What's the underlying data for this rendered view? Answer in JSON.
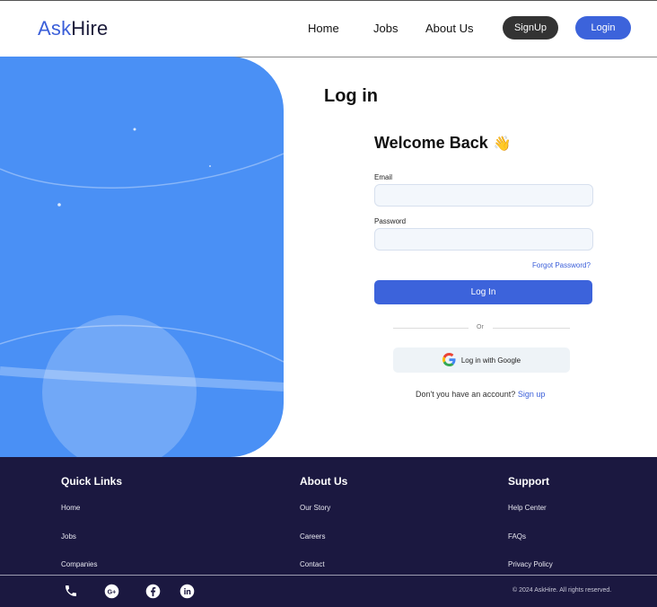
{
  "header": {
    "logo_ask": "Ask",
    "logo_hire": "Hire",
    "nav": [
      "Home",
      "Jobs",
      "About Us"
    ],
    "signup_label": "SignUp",
    "login_label": "Login"
  },
  "form": {
    "title": "Log in",
    "welcome": "Welcome Back",
    "wave": "👋",
    "email_label": "Email",
    "email_value": "",
    "password_label": "Password",
    "password_value": "",
    "forgot": "Forgot Password?",
    "submit": "Log In",
    "or": "Or",
    "google": "Log in with Google",
    "no_account": "Don't you have an account?",
    "signup_link": "Sign up"
  },
  "footer": {
    "quick_links": {
      "heading": "Quick Links",
      "items": [
        "Home",
        "Jobs",
        "Companies"
      ]
    },
    "about": {
      "heading": "About Us",
      "items": [
        "Our Story",
        "Careers",
        "Contact"
      ]
    },
    "support": {
      "heading": "Support",
      "items": [
        "Help Center",
        "FAQs",
        "Privacy Policy"
      ]
    },
    "social_icons": [
      "phone-icon",
      "google-plus-icon",
      "facebook-icon",
      "linkedin-icon"
    ],
    "copyright": "© 2024 AskHire. All rights reserved."
  },
  "colors": {
    "brand": "#3c63db",
    "hero": "#4a90f5",
    "footer": "#1b1840",
    "signup_button": "#333333"
  }
}
